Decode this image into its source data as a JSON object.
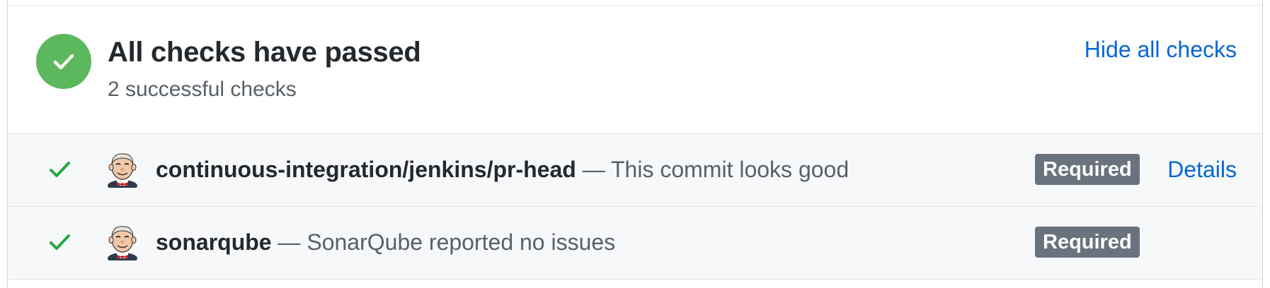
{
  "summary": {
    "title": "All checks have passed",
    "subtitle": "2 successful checks",
    "toggle_label": "Hide all checks",
    "status_icon": "check-circle-icon",
    "status_color": "#5cb85c"
  },
  "checks": [
    {
      "icon": "check-icon",
      "avatar": "jenkins-avatar",
      "name": "continuous-integration/jenkins/pr-head",
      "separator": "—",
      "description": "This commit looks good",
      "badge": "Required",
      "details_label": "Details"
    },
    {
      "icon": "check-icon",
      "avatar": "jenkins-avatar",
      "name": "sonarqube",
      "separator": "—",
      "description": "SonarQube reported no issues",
      "badge": "Required"
    }
  ],
  "colors": {
    "success": "#28a745",
    "link": "#0366d6",
    "badge_bg": "#6a737d"
  }
}
